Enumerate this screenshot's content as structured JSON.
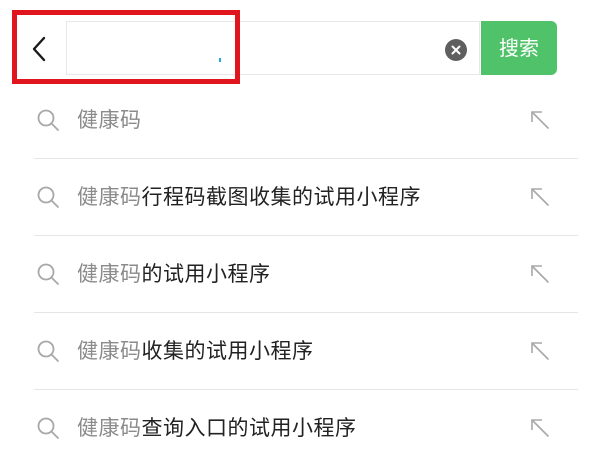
{
  "header": {
    "back_icon": "chevron-left-icon",
    "search": {
      "value": "",
      "placeholder": ""
    },
    "clear_icon": "clear-circle-icon",
    "search_button_label": "搜索",
    "colors": {
      "search_button": "#4fc26a",
      "highlight_frame": "#e0151e",
      "caret": "#2aa9d8"
    }
  },
  "suggestions": [
    {
      "match": "健康码",
      "rest": ""
    },
    {
      "match": "健康码",
      "rest": "行程码截图收集的试用小程序"
    },
    {
      "match": "健康码",
      "rest": "的试用小程序"
    },
    {
      "match": "健康码",
      "rest": "收集的试用小程序"
    },
    {
      "match": "健康码",
      "rest": "查询入口的试用小程序"
    }
  ],
  "suggestion_icons": {
    "leading": "search-icon",
    "trailing": "fill-into-search-arrow-icon"
  }
}
